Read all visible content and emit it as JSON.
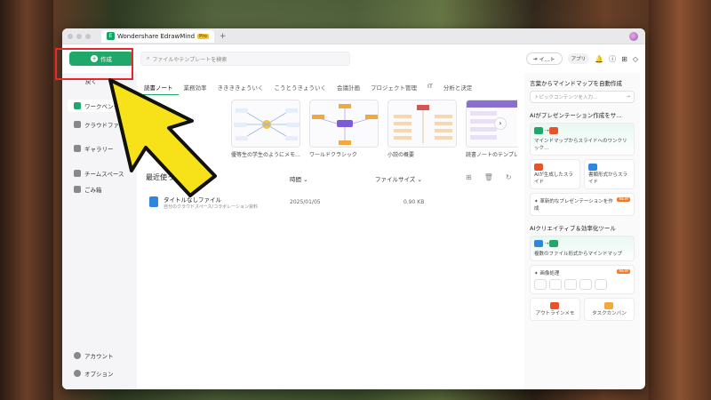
{
  "window": {
    "tab_title": "Wondershare EdrawMind",
    "pro_badge": "Pro"
  },
  "toolbar": {
    "create_label": "作成",
    "search_placeholder": "ファイルやテンプレートを検索",
    "import_label": "イ…ト",
    "apri_label": "アプリ"
  },
  "sidebar": {
    "back_label": "戻く",
    "items": [
      {
        "label": "ワークベンチ"
      },
      {
        "label": "クラウドファ…"
      },
      {
        "label": "ギャラリー"
      },
      {
        "label": "チームスペース"
      },
      {
        "label": "ごみ箱"
      }
    ],
    "bottom": [
      {
        "label": "アカウント"
      },
      {
        "label": "オプション"
      }
    ]
  },
  "main": {
    "tabs": [
      "読書ノート",
      "業務効率",
      "ききききょういく",
      "こうとうきょういく",
      "会議計画",
      "プロジェクト管理",
      "IT",
      "分析と決定"
    ],
    "templates": [
      {
        "label": "優等生の学生のようにメモ…"
      },
      {
        "label": "ワールドクラシック"
      },
      {
        "label": "小説の概要"
      },
      {
        "label": "読書ノートのテンプレ"
      }
    ],
    "recent_title": "最近使ったファイル",
    "col_time": "時間",
    "col_size": "ファイルサイズ",
    "files": [
      {
        "name": "タイトルなしファイル",
        "path": "自分のクラウドスペース/コラボレーション資料",
        "date": "2025/01/05",
        "size": "0.90 KB"
      }
    ]
  },
  "right": {
    "title1": "言葉からマインドマップを自動作成",
    "input_placeholder": "トピックコンテンツを入力…",
    "title2": "AIがプレゼンテーション作成をサ…",
    "card1": "マインドマップからスライドへのワンクリック…",
    "card2a": "AIが生成したスライド",
    "card2b": "書類形式からスライド",
    "card3": "革新的なプレゼンテーションを作成",
    "title3": "AIクリエイティブ＆効率化ツール",
    "card4": "複数のファイル形式からマインドマップ",
    "card5": "画像処理",
    "card6a": "アウトラインメモ",
    "card6b": "タスクカンバン",
    "new_badge": "NEW"
  }
}
